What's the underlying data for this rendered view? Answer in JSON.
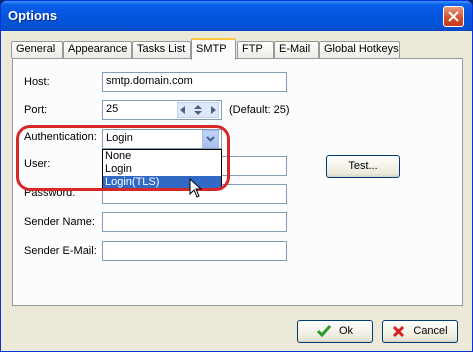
{
  "window": {
    "title": "Options"
  },
  "tabs": [
    {
      "label": "General"
    },
    {
      "label": "Appearance"
    },
    {
      "label": "Tasks List"
    },
    {
      "label": "SMTP",
      "active": true
    },
    {
      "label": "FTP"
    },
    {
      "label": "E-Mail"
    },
    {
      "label": "Global Hotkeys"
    }
  ],
  "smtp": {
    "host_label": "Host:",
    "host_value": "smtp.domain.com",
    "port_label": "Port:",
    "port_value": "25",
    "port_default": "(Default: 25)",
    "auth_label": "Authentication:",
    "auth_value": "Login",
    "auth_options": [
      "None",
      "Login",
      "Login(TLS)"
    ],
    "auth_highlighted": "Login(TLS)",
    "user_label": "User:",
    "user_value": "",
    "password_label": "Password:",
    "password_value": "",
    "test_label": "Test...",
    "sender_name_label": "Sender Name:",
    "sender_name_value": "",
    "sender_email_label": "Sender E-Mail:",
    "sender_email_value": ""
  },
  "footer": {
    "ok_label": "Ok",
    "cancel_label": "Cancel"
  },
  "colors": {
    "accent": "#316ac5",
    "highlight_ring": "#d62828",
    "titlebar": "#0454de"
  }
}
